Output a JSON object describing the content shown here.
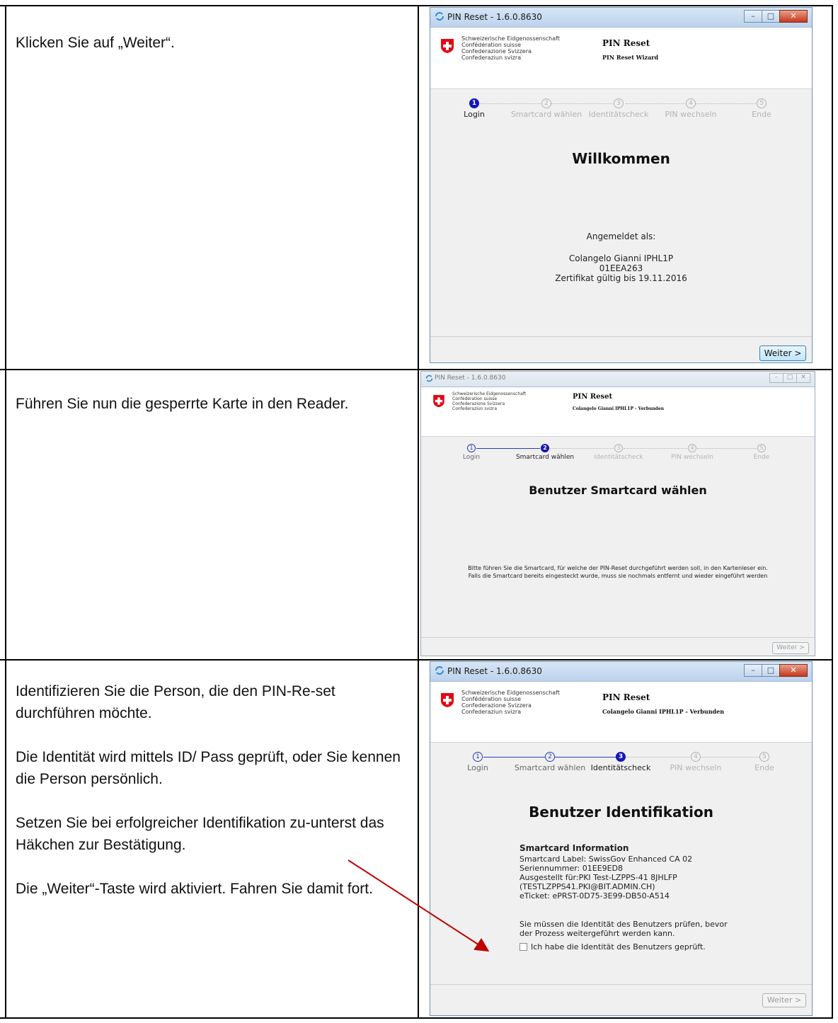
{
  "rows": [
    {
      "instructions": [
        "Klicken Sie auf „Weiter“."
      ],
      "window": {
        "title": "PIN Reset - 1.6.0.8630",
        "confederation": [
          "Schweizerische Eidgenossenschaft",
          "Confédération suisse",
          "Confederazione Svizzera",
          "Confederaziun svizra"
        ],
        "app_name": "PIN Reset",
        "app_subtitle": "PIN Reset Wizard",
        "steps": [
          {
            "number": "1",
            "label": "Login",
            "state": "active"
          },
          {
            "number": "2",
            "label": "Smartcard wählen",
            "state": "pending"
          },
          {
            "number": "3",
            "label": "Identitätscheck",
            "state": "pending"
          },
          {
            "number": "4",
            "label": "PIN wechseln",
            "state": "pending"
          },
          {
            "number": "5",
            "label": "Ende",
            "state": "pending"
          }
        ],
        "heading": "Willkommen",
        "logged_in_label": "Angemeldet als:",
        "user_name": "Colangelo Gianni IPHL1P",
        "user_id": "01EEA263",
        "certificate": "Zertifikat gültig bis 19.11.2016",
        "next_button": "Weiter >"
      }
    },
    {
      "instructions": [
        "Führen Sie nun die gesperrte Karte in den Reader."
      ],
      "window": {
        "title": "PIN Reset - 1.6.0.8630",
        "confederation": [
          "Schweizerische Eidgenossenschaft",
          "Confédération suisse",
          "Confederazione Svizzera",
          "Confederaziun svizra"
        ],
        "app_name": "PIN Reset",
        "app_subtitle": "Colangelo Gianni IPHL1P - Verbunden",
        "steps": [
          {
            "number": "1",
            "label": "Login",
            "state": "done"
          },
          {
            "number": "2",
            "label": "Smartcard wählen",
            "state": "active"
          },
          {
            "number": "3",
            "label": "Identitätscheck",
            "state": "pending"
          },
          {
            "number": "4",
            "label": "PIN wechseln",
            "state": "pending"
          },
          {
            "number": "5",
            "label": "Ende",
            "state": "pending"
          }
        ],
        "heading": "Benutzer Smartcard wählen",
        "message_line1": "Bitte führen Sie die Smartcard, für welche der PIN-Reset durchgeführt werden soll, in den Kartenleser ein.",
        "message_line2": "Falls die Smartcard bereits eingesteckt wurde, muss sie nochmals entfernt und wieder eingeführt werden",
        "next_button": "Weiter >"
      }
    },
    {
      "instructions": [
        "Identifizieren Sie die Person, die den PIN-Re-set durchführen möchte.",
        "Die Identität wird mittels ID/ Pass geprüft, oder Sie kennen die Person persönlich.",
        "Setzen Sie bei erfolgreicher Identifikation zu-unterst das Häkchen zur Bestätigung.",
        "Die „Weiter“-Taste wird aktiviert. Fahren Sie damit fort."
      ],
      "window": {
        "title": "PIN Reset - 1.6.0.8630",
        "confederation": [
          "Schweizerische Eidgenossenschaft",
          "Confédération suisse",
          "Confederazione Svizzera",
          "Confederaziun svizra"
        ],
        "app_name": "PIN Reset",
        "app_subtitle": "Colangelo Gianni IPHL1P - Verbunden",
        "steps": [
          {
            "number": "1",
            "label": "Login",
            "state": "done"
          },
          {
            "number": "2",
            "label": "Smartcard wählen",
            "state": "done"
          },
          {
            "number": "3",
            "label": "Identitätscheck",
            "state": "active"
          },
          {
            "number": "4",
            "label": "PIN wechseln",
            "state": "pending"
          },
          {
            "number": "5",
            "label": "Ende",
            "state": "pending"
          }
        ],
        "heading": "Benutzer Identifikation",
        "info_heading": "Smartcard Information",
        "info_lines": [
          "Smartcard Label: SwissGov Enhanced CA 02",
          "Seriennummer: 01EE9ED8",
          "Ausgestellt für:PKI Test-LZPPS-41 8JHLFP",
          "(TESTLZPPS41.PKI@BIT.ADMIN.CH)",
          "eTicket: ePRST-0D75-3E99-DB50-A514"
        ],
        "warning_line1": "Sie müssen die Identität des Benutzers prüfen, bevor",
        "warning_line2": "der Prozess weitergeführt werden kann.",
        "checkbox_label": "Ich habe die Identität des Benutzers geprüft.",
        "next_button": "Weiter >"
      }
    }
  ],
  "colors": {
    "accent": "#1417b8",
    "arrow": "#c00000",
    "window_bg": "#f0f0f0"
  }
}
